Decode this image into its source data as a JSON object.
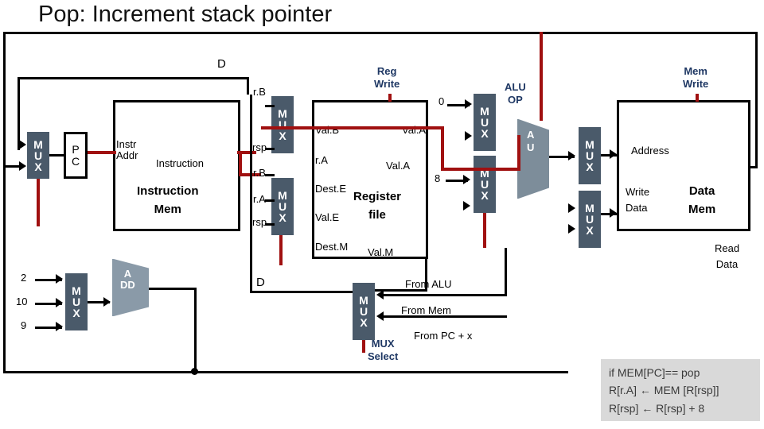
{
  "title": "Pop: Increment stack pointer",
  "labels": {
    "d_top": "D",
    "d_bottom": "D",
    "rB_top": "r.B",
    "rsp_1": "rsp",
    "rB_2": "r.B",
    "rA_2": "r.A",
    "rsp_2": "rsp",
    "valB": "Val.B",
    "valA_mid": "Val.A",
    "rA": "r.A",
    "valA": "Val.A",
    "destE": "Dest.E",
    "valE": "Val.E",
    "destM": "Dest.M",
    "valM": "Val.M",
    "instr_addr": "Instr\nAddr",
    "instruction": "Instruction",
    "instruction_mem": "Instruction\nMem",
    "pc": "P\nC",
    "add": "A\nDD",
    "reg_write": "Reg\nWrite",
    "mem_write": "Mem\nWrite",
    "alu_op": "ALU\nOP",
    "alu_a": "A\nU",
    "register_file": "Register\nfile",
    "address": "Address",
    "write_data": "Write\nData",
    "data_mem": "Data\nMem",
    "read_data": "Read\nData",
    "from_alu": "From ALU",
    "from_mem": "From  Mem",
    "from_pc_x": "From PC + x",
    "mux_select": "MUX\nSelect",
    "const_0": "0",
    "const_8": "8",
    "const_2": "2",
    "const_10": "10",
    "const_9": "9",
    "mux_letters": [
      "M",
      "U",
      "X"
    ]
  },
  "note": {
    "line1": "if MEM[PC]== pop",
    "line2": "R[r.A] ← MEM [R[rsp]]",
    "line3": "R[rsp] ← R[rsp] + 8"
  },
  "colors": {
    "mux_fill": "#4a5a6a",
    "highlight": "#a01010",
    "note_bg": "#d9d9d9",
    "label_blue": "#1f3864"
  }
}
